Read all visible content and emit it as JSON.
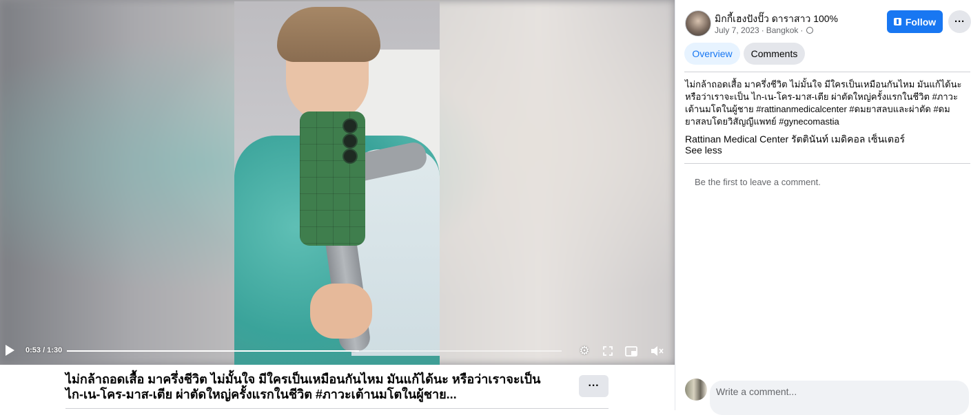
{
  "video": {
    "time": "0:53 / 1:30",
    "progress": 0.59
  },
  "caption": {
    "line1": "ไม่กล้าถอดเสื้อ มาครึ่งชีวิต ไม่มั้นใจ มีใครเป็นเหมือนกันไหม มันแก้ได้นะ หรือว่าเราจะเป็น",
    "line2": "ไก-เน-โคร-มาส-เตีย ผ่าตัดใหญ่ครั้งแรกในชีวิต #ภาวะเต้านมโตในผู้ชาย...",
    "more_label": "···"
  },
  "post": {
    "author": "มิกกี้เฮงปังปั๊ว ดาราสาว 100%",
    "date": "July 7, 2023",
    "location": "Bangkok",
    "follow_label": "Follow",
    "more_label": "···",
    "tabs": [
      "Overview",
      "Comments"
    ],
    "description": "ไม่กล้าถอดเสื้อ มาครึ่งชีวิต ไม่มั้นใจ มีใครเป็นเหมือนกันไหม มันแก้ได้นะ หรือว่าเราจะเป็น ไก-เน-โคร-มาส-เตีย ผ่าตัดใหญ่ครั้งแรกในชีวิต #ภาวะเต้านมโตในผู้ชาย #rattinanmedicalcenter #ดมยาสลบและผ่าตัด #ดมยาสลบโดยวิสัญญีแพทย์ #gynecomastia",
    "page_link": "Rattinan Medical Center รัตตินันท์ เมดิคอล เซ็นเตอร์",
    "see_less": "See less",
    "empty_comments": "Be the first to leave a comment.",
    "comment_placeholder": "Write a comment..."
  }
}
